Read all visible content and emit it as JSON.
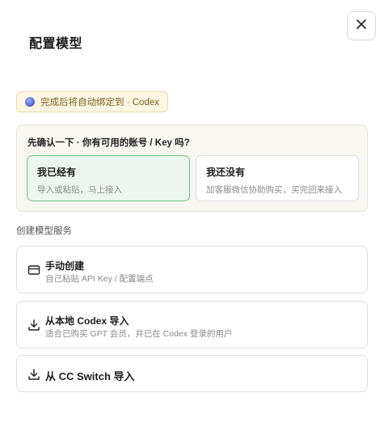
{
  "dialog": {
    "title": "配置模型",
    "close_icon": "close-icon"
  },
  "badge": {
    "text": "完成后将自动绑定到 · Codex",
    "icon": "codex-logo-icon"
  },
  "confirm": {
    "question": "先确认一下 · 你有可用的账号 / Key 吗?",
    "options": [
      {
        "title": "我已经有",
        "subtitle": "导入或粘贴，马上接入",
        "selected": true
      },
      {
        "title": "我还没有",
        "subtitle": "加客服微信协助购买，买完回来接入",
        "selected": false
      }
    ],
    "accent": "#6cc08a"
  },
  "create_section": {
    "label": "创建模型服务",
    "options": [
      {
        "icon": "credit-card-icon",
        "title": "手动创建",
        "subtitle": "自己粘贴 API Key / 配置端点"
      },
      {
        "icon": "download-icon",
        "title": "从本地 Codex 导入",
        "subtitle": "适合已购买 GPT 会员，并已在 Codex 登录的用户"
      },
      {
        "icon": "download-icon",
        "title": "从 CC Switch 导入"
      }
    ]
  }
}
